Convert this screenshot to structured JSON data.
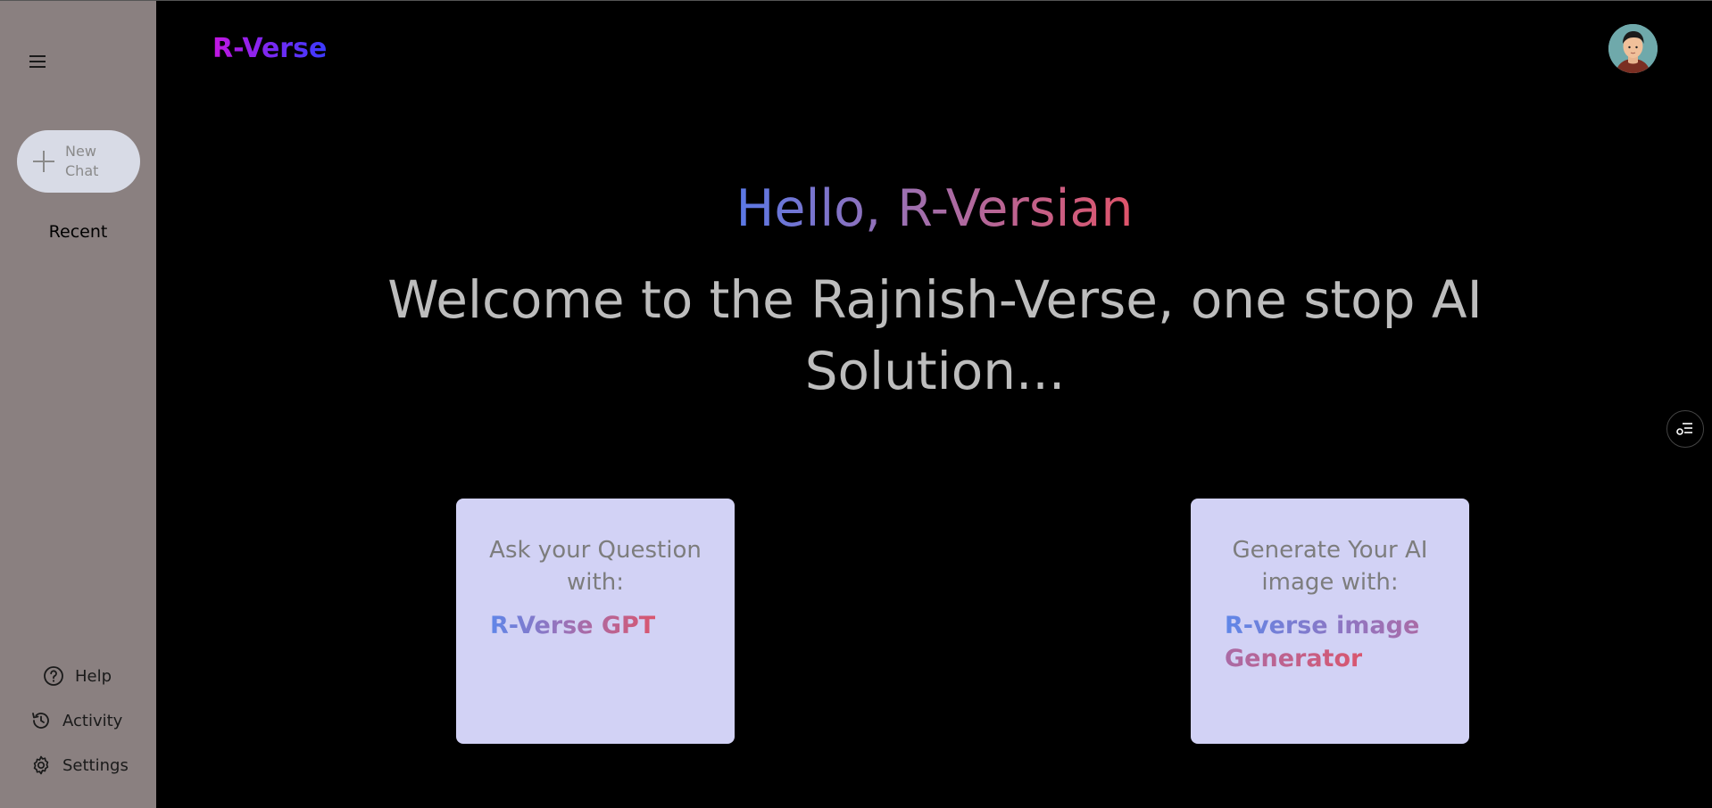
{
  "app": {
    "logo": "R-Verse"
  },
  "sidebar": {
    "new_chat_label": "New Chat",
    "recent_label": "Recent",
    "help_label": "Help",
    "activity_label": "Activity",
    "settings_label": "Settings"
  },
  "main": {
    "greeting": "Hello, R-Versian",
    "welcome": "Welcome to the Rajnish-Verse, one stop AI Solution..."
  },
  "cards": [
    {
      "question": "Ask your Question with:",
      "brand": "R-Verse GPT"
    },
    {
      "question": "Generate Your AI image with:",
      "brand": "R-verse image Generator"
    }
  ],
  "colors": {
    "sidebar_bg": "#8a8080",
    "main_bg": "#000000",
    "card_bg": "#d2d2f5",
    "new_chat_bg": "#d8dbe6",
    "welcome_text": "#bdbdbd"
  }
}
